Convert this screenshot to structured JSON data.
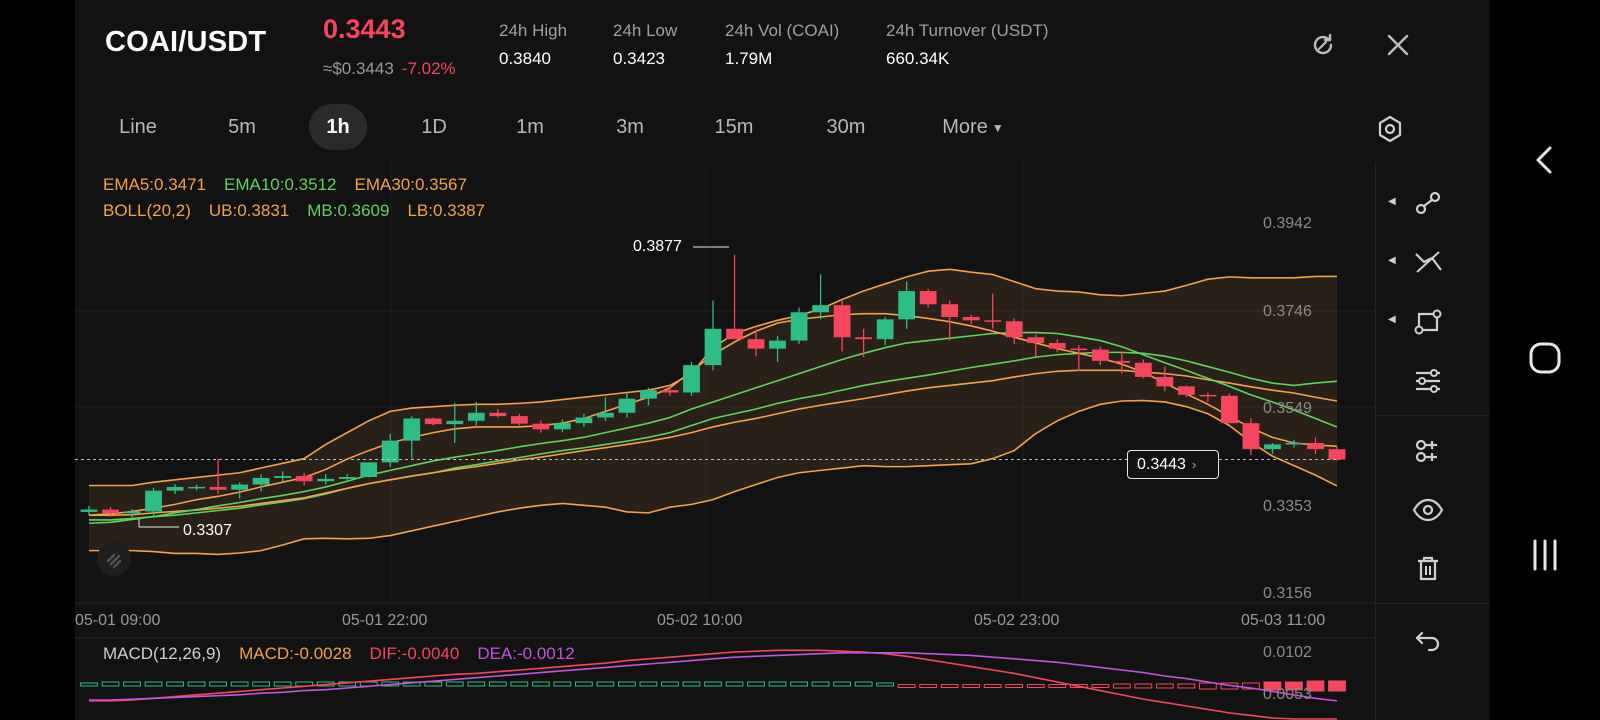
{
  "header": {
    "pair": "COAI/USDT",
    "last_price": "0.3443",
    "usd_price": "≈$0.3443",
    "change_pct": "-7.02%",
    "stats": [
      {
        "label": "24h  High",
        "value": "0.3840"
      },
      {
        "label": "24h  Low",
        "value": "0.3423"
      },
      {
        "label": "24h  Vol (COAI)",
        "value": "1.79M"
      },
      {
        "label": "24h  Turnover (USDT)",
        "value": "660.34K"
      }
    ],
    "icons": {
      "refresh": "refresh-icon",
      "close": "close-icon"
    }
  },
  "tabs": [
    "Line",
    "5m",
    "1h",
    "1D",
    "1m",
    "3m",
    "15m",
    "30m",
    "More"
  ],
  "active_tab": "1h",
  "indicators": {
    "ema": [
      {
        "label": "EMA5:0.3471",
        "color": "#f5a04a"
      },
      {
        "label": "EMA10:0.3512",
        "color": "#5fd35b"
      },
      {
        "label": "EMA30:0.3567",
        "color": "#f5a04a"
      }
    ],
    "boll": [
      {
        "label": "BOLL(20,2)",
        "color": "#f5a04a"
      },
      {
        "label": "UB:0.3831",
        "color": "#f5a04a"
      },
      {
        "label": "MB:0.3609",
        "color": "#5fd35b"
      },
      {
        "label": "LB:0.3387",
        "color": "#f5a04a"
      }
    ],
    "macd": [
      {
        "label": "MACD(12,26,9)",
        "color": "#cfcfcf"
      },
      {
        "label": "MACD:-0.0028",
        "color": "#f5a04a"
      },
      {
        "label": "DIF:-0.0040",
        "color": "#f6465d"
      },
      {
        "label": "DEA:-0.0012",
        "color": "#c154e0"
      }
    ]
  },
  "chart_data": {
    "type": "candlestick",
    "interval": "1h",
    "y_ticks": [
      "0.3942",
      "0.3746",
      "0.3549",
      "0.3353",
      "0.3156"
    ],
    "ylim": [
      0.3156,
      0.3942
    ],
    "x_ticks": [
      "05-01 09:00",
      "05-01 22:00",
      "05-02 10:00",
      "05-02 23:00",
      "05-03 11:00"
    ],
    "high_marker": "0.3877",
    "low_marker": "0.3307",
    "current_price_label": "0.3443",
    "macd_ticks": [
      "0.0102",
      "0.0053"
    ],
    "candles": [
      {
        "o": 0.3332,
        "h": 0.3345,
        "l": 0.3325,
        "c": 0.3337
      },
      {
        "o": 0.3337,
        "h": 0.3342,
        "l": 0.3322,
        "c": 0.3329
      },
      {
        "o": 0.3329,
        "h": 0.3338,
        "l": 0.332,
        "c": 0.3333
      },
      {
        "o": 0.3333,
        "h": 0.3383,
        "l": 0.3323,
        "c": 0.3377
      },
      {
        "o": 0.3377,
        "h": 0.3391,
        "l": 0.337,
        "c": 0.3385
      },
      {
        "o": 0.3385,
        "h": 0.339,
        "l": 0.3378,
        "c": 0.3385
      },
      {
        "o": 0.3385,
        "h": 0.3445,
        "l": 0.337,
        "c": 0.3379
      },
      {
        "o": 0.3379,
        "h": 0.3395,
        "l": 0.336,
        "c": 0.339
      },
      {
        "o": 0.339,
        "h": 0.3412,
        "l": 0.3375,
        "c": 0.3404
      },
      {
        "o": 0.3404,
        "h": 0.3418,
        "l": 0.3395,
        "c": 0.3408
      },
      {
        "o": 0.3408,
        "h": 0.3415,
        "l": 0.3388,
        "c": 0.3397
      },
      {
        "o": 0.3397,
        "h": 0.3412,
        "l": 0.339,
        "c": 0.3402
      },
      {
        "o": 0.3402,
        "h": 0.3412,
        "l": 0.3395,
        "c": 0.3406
      },
      {
        "o": 0.3406,
        "h": 0.3437,
        "l": 0.3405,
        "c": 0.3437
      },
      {
        "o": 0.3437,
        "h": 0.3497,
        "l": 0.3427,
        "c": 0.3483
      },
      {
        "o": 0.3483,
        "h": 0.3535,
        "l": 0.3445,
        "c": 0.353
      },
      {
        "o": 0.353,
        "h": 0.3532,
        "l": 0.3515,
        "c": 0.3518
      },
      {
        "o": 0.3518,
        "h": 0.3563,
        "l": 0.3478,
        "c": 0.3525
      },
      {
        "o": 0.3525,
        "h": 0.3565,
        "l": 0.3515,
        "c": 0.3542
      },
      {
        "o": 0.3542,
        "h": 0.355,
        "l": 0.3532,
        "c": 0.3535
      },
      {
        "o": 0.3535,
        "h": 0.354,
        "l": 0.3515,
        "c": 0.3519
      },
      {
        "o": 0.3519,
        "h": 0.3525,
        "l": 0.35,
        "c": 0.3507
      },
      {
        "o": 0.3507,
        "h": 0.3528,
        "l": 0.3501,
        "c": 0.352
      },
      {
        "o": 0.352,
        "h": 0.354,
        "l": 0.3512,
        "c": 0.3532
      },
      {
        "o": 0.3532,
        "h": 0.3575,
        "l": 0.3525,
        "c": 0.3542
      },
      {
        "o": 0.3542,
        "h": 0.3585,
        "l": 0.3532,
        "c": 0.3572
      },
      {
        "o": 0.3572,
        "h": 0.3595,
        "l": 0.3558,
        "c": 0.359
      },
      {
        "o": 0.359,
        "h": 0.3598,
        "l": 0.3578,
        "c": 0.3585
      },
      {
        "o": 0.3585,
        "h": 0.365,
        "l": 0.3578,
        "c": 0.3643
      },
      {
        "o": 0.3643,
        "h": 0.378,
        "l": 0.3632,
        "c": 0.372
      },
      {
        "o": 0.372,
        "h": 0.3877,
        "l": 0.37,
        "c": 0.3698
      },
      {
        "o": 0.3698,
        "h": 0.3718,
        "l": 0.3662,
        "c": 0.3678
      },
      {
        "o": 0.3678,
        "h": 0.3705,
        "l": 0.365,
        "c": 0.3695
      },
      {
        "o": 0.3695,
        "h": 0.3765,
        "l": 0.3688,
        "c": 0.3755
      },
      {
        "o": 0.3755,
        "h": 0.3835,
        "l": 0.374,
        "c": 0.377
      },
      {
        "o": 0.377,
        "h": 0.3782,
        "l": 0.3672,
        "c": 0.3702
      },
      {
        "o": 0.3702,
        "h": 0.372,
        "l": 0.366,
        "c": 0.3698
      },
      {
        "o": 0.3698,
        "h": 0.3745,
        "l": 0.3685,
        "c": 0.374
      },
      {
        "o": 0.374,
        "h": 0.382,
        "l": 0.372,
        "c": 0.38
      },
      {
        "o": 0.38,
        "h": 0.3805,
        "l": 0.3765,
        "c": 0.3772
      },
      {
        "o": 0.3772,
        "h": 0.378,
        "l": 0.3695,
        "c": 0.3745
      },
      {
        "o": 0.3745,
        "h": 0.375,
        "l": 0.373,
        "c": 0.3738
      },
      {
        "o": 0.3738,
        "h": 0.3795,
        "l": 0.372,
        "c": 0.3736
      },
      {
        "o": 0.3736,
        "h": 0.3742,
        "l": 0.3688,
        "c": 0.3702
      },
      {
        "o": 0.3702,
        "h": 0.3708,
        "l": 0.3662,
        "c": 0.369
      },
      {
        "o": 0.369,
        "h": 0.3698,
        "l": 0.367,
        "c": 0.3678
      },
      {
        "o": 0.3678,
        "h": 0.3685,
        "l": 0.363,
        "c": 0.3676
      },
      {
        "o": 0.3676,
        "h": 0.3682,
        "l": 0.3643,
        "c": 0.3652
      },
      {
        "o": 0.3652,
        "h": 0.3672,
        "l": 0.3625,
        "c": 0.3648
      },
      {
        "o": 0.3648,
        "h": 0.3655,
        "l": 0.3615,
        "c": 0.3618
      },
      {
        "o": 0.3618,
        "h": 0.364,
        "l": 0.3588,
        "c": 0.3598
      },
      {
        "o": 0.3598,
        "h": 0.36,
        "l": 0.3575,
        "c": 0.358
      },
      {
        "o": 0.358,
        "h": 0.3585,
        "l": 0.3565,
        "c": 0.3578
      },
      {
        "o": 0.3578,
        "h": 0.3583,
        "l": 0.352,
        "c": 0.352
      },
      {
        "o": 0.352,
        "h": 0.353,
        "l": 0.3452,
        "c": 0.3465
      },
      {
        "o": 0.3465,
        "h": 0.3478,
        "l": 0.3455,
        "c": 0.3475
      },
      {
        "o": 0.3475,
        "h": 0.3485,
        "l": 0.3468,
        "c": 0.3478
      },
      {
        "o": 0.3478,
        "h": 0.349,
        "l": 0.3455,
        "c": 0.3465
      },
      {
        "o": 0.3465,
        "h": 0.347,
        "l": 0.344,
        "c": 0.3443
      }
    ],
    "series_ub": [
      0.3388,
      0.3388,
      0.3388,
      0.3395,
      0.34,
      0.3405,
      0.341,
      0.3415,
      0.3425,
      0.3435,
      0.3445,
      0.3475,
      0.35,
      0.3525,
      0.3545,
      0.3552,
      0.3555,
      0.3558,
      0.356,
      0.356,
      0.3562,
      0.3565,
      0.357,
      0.3575,
      0.358,
      0.3585,
      0.359,
      0.36,
      0.3625,
      0.368,
      0.371,
      0.3725,
      0.3738,
      0.3748,
      0.3762,
      0.3782,
      0.38,
      0.3815,
      0.383,
      0.3842,
      0.3846,
      0.384,
      0.3835,
      0.382,
      0.3805,
      0.38,
      0.3798,
      0.3792,
      0.379,
      0.3795,
      0.38,
      0.3812,
      0.3825,
      0.383,
      0.3828,
      0.3828,
      0.3828,
      0.3831,
      0.3831
    ],
    "series_lb": [
      0.325,
      0.325,
      0.325,
      0.3248,
      0.3244,
      0.3244,
      0.3242,
      0.3245,
      0.325,
      0.3262,
      0.3275,
      0.3276,
      0.3275,
      0.3276,
      0.3282,
      0.3292,
      0.3302,
      0.3312,
      0.3322,
      0.3332,
      0.334,
      0.3346,
      0.335,
      0.3346,
      0.3342,
      0.3332,
      0.333,
      0.3342,
      0.3348,
      0.3358,
      0.3375,
      0.339,
      0.3405,
      0.3415,
      0.342,
      0.3425,
      0.343,
      0.3428,
      0.3428,
      0.343,
      0.3432,
      0.3434,
      0.3445,
      0.3462,
      0.3498,
      0.3525,
      0.3545,
      0.356,
      0.3567,
      0.3568,
      0.3565,
      0.3555,
      0.354,
      0.3515,
      0.348,
      0.345,
      0.343,
      0.341,
      0.3387
    ],
    "series_mb": [
      0.3315,
      0.3315,
      0.3318,
      0.3322,
      0.3325,
      0.333,
      0.3335,
      0.334,
      0.3347,
      0.3353,
      0.336,
      0.337,
      0.3382,
      0.3392,
      0.34,
      0.3408,
      0.3415,
      0.3425,
      0.3432,
      0.344,
      0.3447,
      0.3455,
      0.3462,
      0.3468,
      0.3475,
      0.3482,
      0.349,
      0.35,
      0.3515,
      0.353,
      0.354,
      0.355,
      0.3562,
      0.3572,
      0.358,
      0.359,
      0.36,
      0.3608,
      0.3615,
      0.3622,
      0.363,
      0.3638,
      0.3645,
      0.3652,
      0.366,
      0.3665,
      0.3668,
      0.367,
      0.367,
      0.3668,
      0.3662,
      0.3652,
      0.364,
      0.3628,
      0.3615,
      0.3605,
      0.36,
      0.3605,
      0.3609
    ],
    "series_ema30": [
      0.3325,
      0.3325,
      0.3326,
      0.333,
      0.3333,
      0.3336,
      0.334,
      0.3344,
      0.335,
      0.3356,
      0.3362,
      0.3372,
      0.3382,
      0.3392,
      0.34,
      0.3408,
      0.3415,
      0.3422,
      0.3428,
      0.3435,
      0.3442,
      0.3448,
      0.3455,
      0.3462,
      0.3468,
      0.3475,
      0.3482,
      0.349,
      0.35,
      0.3512,
      0.3522,
      0.353,
      0.354,
      0.355,
      0.3558,
      0.3565,
      0.3572,
      0.358,
      0.3588,
      0.3595,
      0.36,
      0.3605,
      0.361,
      0.3618,
      0.3625,
      0.363,
      0.3632,
      0.3632,
      0.3632,
      0.3628,
      0.3625,
      0.362,
      0.3612,
      0.3605,
      0.3597,
      0.359,
      0.3584,
      0.3575,
      0.3567
    ],
    "series_ema10": [
      0.3308,
      0.331,
      0.3316,
      0.3322,
      0.333,
      0.3337,
      0.3345,
      0.3352,
      0.336,
      0.3367,
      0.3375,
      0.3385,
      0.3397,
      0.341,
      0.342,
      0.343,
      0.344,
      0.3448,
      0.3455,
      0.3462,
      0.347,
      0.3477,
      0.3483,
      0.349,
      0.35,
      0.351,
      0.352,
      0.3532,
      0.355,
      0.3565,
      0.358,
      0.3595,
      0.361,
      0.3625,
      0.364,
      0.3655,
      0.3668,
      0.368,
      0.369,
      0.3695,
      0.37,
      0.3705,
      0.371,
      0.3712,
      0.3712,
      0.371,
      0.3703,
      0.3695,
      0.3682,
      0.3665,
      0.3648,
      0.3632,
      0.3615,
      0.3598,
      0.358,
      0.3565,
      0.3548,
      0.353,
      0.3512
    ],
    "series_ema5": [
      0.3325,
      0.3328,
      0.3333,
      0.334,
      0.3348,
      0.3358,
      0.3365,
      0.3374,
      0.3385,
      0.3395,
      0.3405,
      0.3422,
      0.3444,
      0.3462,
      0.3478,
      0.349,
      0.35,
      0.3508,
      0.3512,
      0.3512,
      0.3512,
      0.3515,
      0.352,
      0.353,
      0.3545,
      0.356,
      0.3575,
      0.3595,
      0.363,
      0.3665,
      0.3692,
      0.3715,
      0.3732,
      0.374,
      0.3745,
      0.375,
      0.3752,
      0.3752,
      0.3748,
      0.3742,
      0.3735,
      0.3726,
      0.3715,
      0.3702,
      0.369,
      0.3678,
      0.3668,
      0.3658,
      0.3645,
      0.3628,
      0.3605,
      0.3582,
      0.356,
      0.3535,
      0.351,
      0.349,
      0.3478,
      0.3474,
      0.3471
    ],
    "series_dif": [
      0.0045,
      0.0045,
      0.0046,
      0.0048,
      0.005,
      0.0052,
      0.0054,
      0.0056,
      0.0058,
      0.006,
      0.0062,
      0.0064,
      0.0066,
      0.0068,
      0.007,
      0.0072,
      0.0074,
      0.0076,
      0.0077,
      0.0079,
      0.0081,
      0.0083,
      0.0085,
      0.0087,
      0.0089,
      0.0092,
      0.0094,
      0.0096,
      0.0098,
      0.01,
      0.0102,
      0.0103,
      0.0104,
      0.0104,
      0.0104,
      0.0103,
      0.0102,
      0.01,
      0.0097,
      0.0093,
      0.0089,
      0.0085,
      0.0081,
      0.0077,
      0.0072,
      0.0067,
      0.0062,
      0.0057,
      0.0052,
      0.0047,
      0.0043,
      0.0039,
      0.0035,
      0.0031,
      0.0028,
      0.0025,
      0.0022,
      0.002,
      0.0018
    ],
    "series_dea": [
      0.0046,
      0.0046,
      0.0047,
      0.0048,
      0.0049,
      0.005,
      0.0051,
      0.0052,
      0.0054,
      0.0055,
      0.0057,
      0.0058,
      0.006,
      0.0062,
      0.0064,
      0.0066,
      0.0068,
      0.007,
      0.0072,
      0.0074,
      0.0076,
      0.0078,
      0.008,
      0.0082,
      0.0084,
      0.0086,
      0.0088,
      0.009,
      0.0092,
      0.0094,
      0.0096,
      0.0097,
      0.0098,
      0.0099,
      0.01,
      0.0101,
      0.0101,
      0.0101,
      0.0101,
      0.01,
      0.0099,
      0.0098,
      0.0096,
      0.0094,
      0.0092,
      0.009,
      0.0087,
      0.0084,
      0.0081,
      0.0078,
      0.0074,
      0.0071,
      0.0067,
      0.0063,
      0.006,
      0.0056,
      0.0052,
      0.0048,
      0.0045
    ],
    "macd_hist": [
      0.0,
      0.0001,
      0.0001,
      0.0001,
      0.0001,
      0.0001,
      0.0001,
      0.0001,
      0.0001,
      0.0001,
      0.0001,
      0.0001,
      0.0001,
      0.0001,
      0.0001,
      0.0001,
      0.0001,
      0.0001,
      0.0001,
      0.0001,
      0.0001,
      0.0001,
      0.0001,
      0.0001,
      0.0001,
      0.0001,
      0.0001,
      0.0001,
      0.0001,
      0.0001,
      0.0001,
      0.0001,
      0.0001,
      0.0001,
      0.0001,
      0.0001,
      0.0001,
      0.0,
      -0.0001,
      -0.0001,
      -0.0001,
      -0.0001,
      -0.0001,
      -0.0001,
      -0.0001,
      -0.0001,
      -0.0001,
      -0.0001,
      -0.0002,
      -0.0002,
      -0.0002,
      -0.0002,
      -0.0003,
      -0.0003,
      -0.0003,
      -0.0004,
      -0.0004,
      -0.0005,
      -0.0005
    ],
    "colors": {
      "up": "#2ebd85",
      "down": "#f6465d",
      "ema_orange": "#f5a04a",
      "ema_green": "#5fd35b",
      "dif": "#f6465d",
      "dea": "#c154e0"
    }
  },
  "toolbar_icons": [
    "line-tool-icon",
    "cross-tool-icon",
    "shape-tool-icon",
    "settings-sliders-icon",
    "indicator-icon",
    "eye-icon",
    "trash-icon",
    "undo-icon"
  ],
  "nav_icons": [
    "back-icon",
    "home-icon",
    "recents-icon"
  ]
}
